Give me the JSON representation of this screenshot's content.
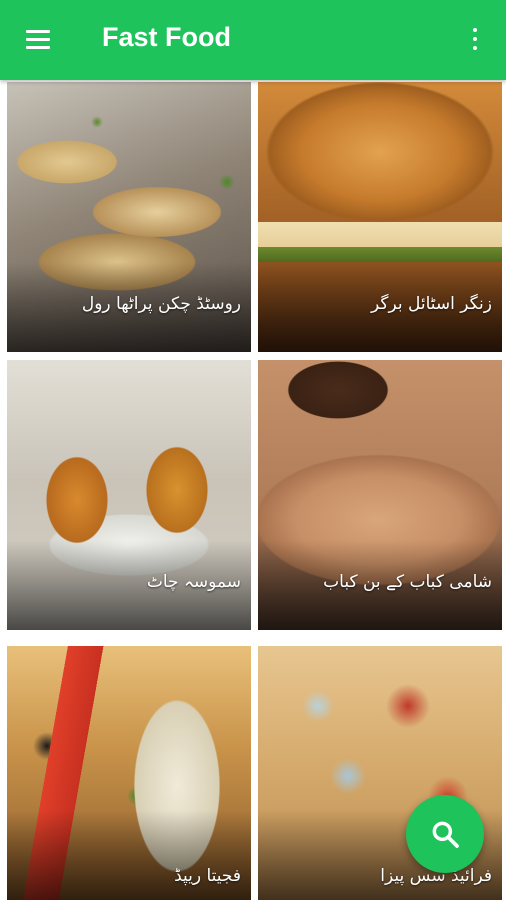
{
  "app_bar": {
    "title": "Fast Food",
    "menu_icon": "hamburger-menu-icon",
    "overflow_icon": "more-vert-icon",
    "background_color": "#1fc35b"
  },
  "recipes": [
    {
      "label": "روسٹڈ چکن پراٹھا رول"
    },
    {
      "label": "زنگر اسٹائل برگر"
    },
    {
      "label": "سموسہ چاٹ"
    },
    {
      "label": "شامی کباب کے بن کباب"
    },
    {
      "label": "فجیتا ریپڈ"
    },
    {
      "label": "فرائیڈ سس پیزا"
    }
  ],
  "fab": {
    "icon": "search-icon",
    "color": "#1fc35b"
  }
}
